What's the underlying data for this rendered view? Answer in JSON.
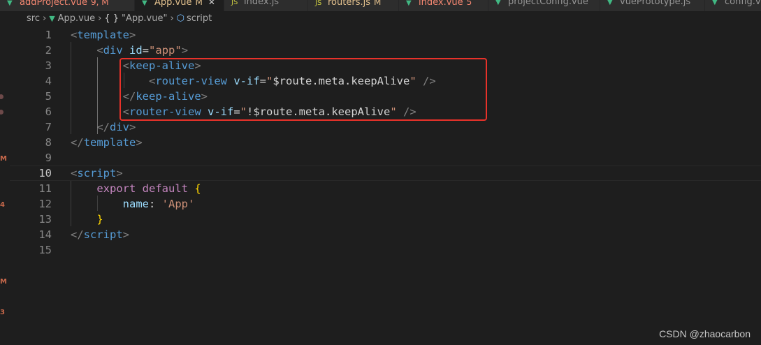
{
  "tabs": [
    {
      "name": "addProject.vue",
      "status": "9, M",
      "type": "vue",
      "active": false
    },
    {
      "name": "App.vue",
      "status": "M",
      "type": "vue",
      "active": true
    },
    {
      "name": "index.js",
      "status": "",
      "type": "js",
      "active": false
    },
    {
      "name": "routers.js",
      "status": "M",
      "type": "js",
      "active": false
    },
    {
      "name": "index.vue",
      "status": "5",
      "type": "vue",
      "active": false
    },
    {
      "name": "projectConfig.vue",
      "status": "",
      "type": "vue",
      "active": false
    },
    {
      "name": "vuePrototype.js",
      "status": "",
      "type": "js",
      "active": false
    },
    {
      "name": "config.vue",
      "status": "",
      "type": "vue",
      "active": false
    }
  ],
  "breadcrumb": {
    "folder": "src",
    "file": "App.vue",
    "section": "\"App.vue\"",
    "symbol": "script"
  },
  "editor": {
    "active_line": 10,
    "lines": [
      {
        "n": "1",
        "tokens": [
          [
            "t-punct",
            "<"
          ],
          [
            "t-tag",
            "template"
          ],
          [
            "t-punct",
            ">"
          ]
        ]
      },
      {
        "n": "2",
        "tokens": [
          [
            "t-expr",
            "    "
          ],
          [
            "t-punct",
            "<"
          ],
          [
            "t-tag",
            "div"
          ],
          [
            "t-expr",
            " "
          ],
          [
            "t-attr",
            "id"
          ],
          [
            "t-expr",
            "="
          ],
          [
            "t-str",
            "\"app\""
          ],
          [
            "t-punct",
            ">"
          ]
        ]
      },
      {
        "n": "3",
        "tokens": [
          [
            "t-expr",
            "        "
          ],
          [
            "t-punct",
            "<"
          ],
          [
            "t-tag",
            "keep-alive"
          ],
          [
            "t-punct",
            ">"
          ]
        ]
      },
      {
        "n": "4",
        "tokens": [
          [
            "t-expr",
            "            "
          ],
          [
            "t-punct",
            "<"
          ],
          [
            "t-tag",
            "router-view"
          ],
          [
            "t-expr",
            " "
          ],
          [
            "t-attr",
            "v-if"
          ],
          [
            "t-expr",
            "="
          ],
          [
            "t-str",
            "\""
          ],
          [
            "t-expr",
            "$route.meta.keepAlive"
          ],
          [
            "t-str",
            "\""
          ],
          [
            "t-expr",
            " "
          ],
          [
            "t-punct",
            "/>"
          ]
        ]
      },
      {
        "n": "5",
        "tokens": [
          [
            "t-expr",
            "        "
          ],
          [
            "t-punct",
            "</"
          ],
          [
            "t-tag",
            "keep-alive"
          ],
          [
            "t-punct",
            ">"
          ]
        ]
      },
      {
        "n": "6",
        "tokens": [
          [
            "t-expr",
            "        "
          ],
          [
            "t-punct",
            "<"
          ],
          [
            "t-tag",
            "router-view"
          ],
          [
            "t-expr",
            " "
          ],
          [
            "t-attr",
            "v-if"
          ],
          [
            "t-expr",
            "="
          ],
          [
            "t-str",
            "\""
          ],
          [
            "t-expr",
            "!$route.meta.keepAlive"
          ],
          [
            "t-str",
            "\""
          ],
          [
            "t-expr",
            " "
          ],
          [
            "t-punct",
            "/>"
          ]
        ]
      },
      {
        "n": "7",
        "tokens": [
          [
            "t-expr",
            "    "
          ],
          [
            "t-punct",
            "</"
          ],
          [
            "t-tag",
            "div"
          ],
          [
            "t-punct",
            ">"
          ]
        ]
      },
      {
        "n": "8",
        "tokens": [
          [
            "t-punct",
            "</"
          ],
          [
            "t-tag",
            "template"
          ],
          [
            "t-punct",
            ">"
          ]
        ]
      },
      {
        "n": "9",
        "tokens": []
      },
      {
        "n": "10",
        "tokens": [
          [
            "t-punct",
            "<"
          ],
          [
            "t-tag",
            "script"
          ],
          [
            "t-punct",
            ">"
          ]
        ]
      },
      {
        "n": "11",
        "tokens": [
          [
            "t-expr",
            "    "
          ],
          [
            "t-kw",
            "export"
          ],
          [
            "t-expr",
            " "
          ],
          [
            "t-kw",
            "default"
          ],
          [
            "t-expr",
            " "
          ],
          [
            "t-brace",
            "{"
          ]
        ]
      },
      {
        "n": "12",
        "tokens": [
          [
            "t-expr",
            "        "
          ],
          [
            "t-prop",
            "name"
          ],
          [
            "t-expr",
            ": "
          ],
          [
            "t-str",
            "'App'"
          ]
        ]
      },
      {
        "n": "13",
        "tokens": [
          [
            "t-expr",
            "    "
          ],
          [
            "t-brace",
            "}"
          ]
        ]
      },
      {
        "n": "14",
        "tokens": [
          [
            "t-punct",
            "</"
          ],
          [
            "t-tag",
            "script"
          ],
          [
            "t-punct",
            ">"
          ]
        ]
      },
      {
        "n": "15",
        "tokens": []
      }
    ]
  },
  "left_edge_markers": [
    "M",
    "4",
    "M",
    "3"
  ],
  "watermark": "CSDN @zhaocarbon",
  "colors": {
    "background": "#1e1e1e",
    "highlight_border": "#e8322a",
    "vue_icon": "#41b883",
    "js_icon": "#cbcb41",
    "modified": "#e2c08d",
    "error": "#f14c4c"
  }
}
